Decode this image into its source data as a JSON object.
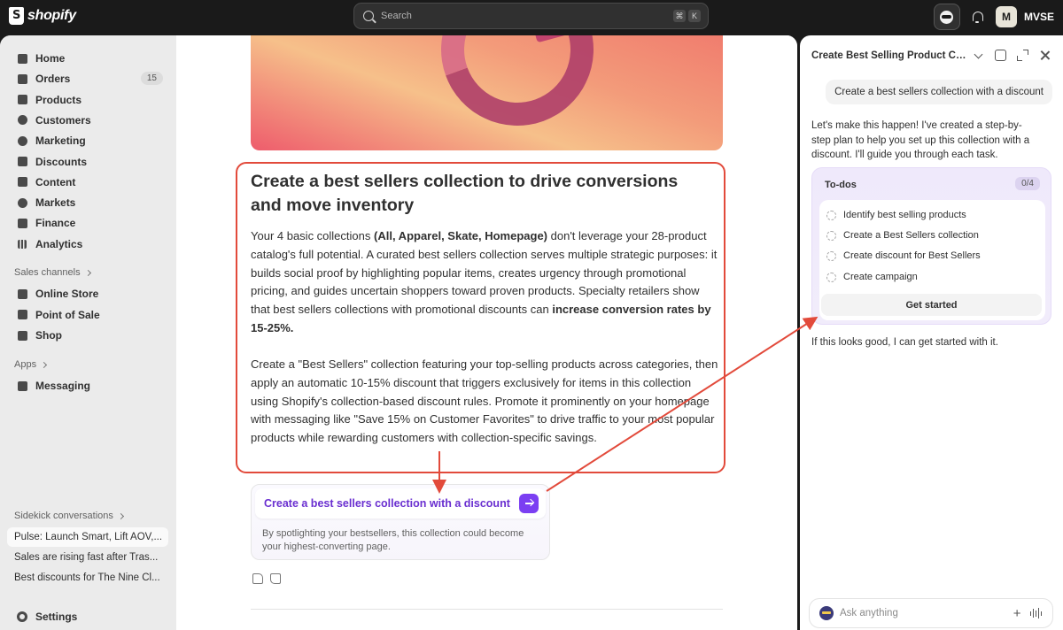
{
  "topbar": {
    "brand": "shopify",
    "search_placeholder": "Search",
    "shortcut_keys": [
      "⌘",
      "K"
    ],
    "store_initial": "M",
    "store_name": "MVSE"
  },
  "sidebar": {
    "nav": [
      {
        "label": "Home",
        "icon": "home-icon"
      },
      {
        "label": "Orders",
        "icon": "orders-icon",
        "badge": "15"
      },
      {
        "label": "Products",
        "icon": "tag-icon"
      },
      {
        "label": "Customers",
        "icon": "person-icon"
      },
      {
        "label": "Marketing",
        "icon": "target-icon"
      },
      {
        "label": "Discounts",
        "icon": "discount-icon"
      },
      {
        "label": "Content",
        "icon": "content-icon"
      },
      {
        "label": "Markets",
        "icon": "globe-icon"
      },
      {
        "label": "Finance",
        "icon": "bank-icon"
      },
      {
        "label": "Analytics",
        "icon": "bar-chart-icon"
      }
    ],
    "sales_channels_title": "Sales channels",
    "sales_channels": [
      {
        "label": "Online Store",
        "icon": "store-icon"
      },
      {
        "label": "Point of Sale",
        "icon": "pos-icon"
      },
      {
        "label": "Shop",
        "icon": "shop-icon"
      }
    ],
    "apps_title": "Apps",
    "apps": [
      {
        "label": "Messaging",
        "icon": "messaging-icon"
      }
    ],
    "conversations_title": "Sidekick conversations",
    "conversations": [
      "Pulse: Launch Smart, Lift AOV,...",
      "Sales are rising fast after Tras...",
      "Best discounts for The Nine Cl..."
    ],
    "settings_label": "Settings"
  },
  "main": {
    "title": "Create a best sellers collection to drive conversions and move inventory",
    "para1_a": "Your 4 basic collections ",
    "para1_b": "(All, Apparel, Skate, Homepage)",
    "para1_c": " don't leverage your 28-product catalog's full potential. A curated best sellers collection serves multiple strategic purposes: it builds social proof by highlighting popular items, creates urgency through promotional pricing, and guides uncertain shoppers toward proven products. Specialty retailers show that best  sellers collections with promotional discounts can ",
    "para1_d": "increase conversion rates by 15-25%.",
    "para2": "Create a \"Best Sellers\" collection featuring your top-selling products across categories, then apply an automatic 10-15% discount that triggers exclusively for items in this collection using Shopify's collection-based discount rules. Promote it prominently on your homepage with messaging like \"Save 15% on Customer Favorites\" to drive traffic to your most popular products while rewarding customers with collection-specific savings.",
    "cta_label": "Create a best sellers collection with a discount",
    "cta_desc": "By spotlighting your bestsellers, this collection could become your highest-converting page."
  },
  "panel": {
    "title": "Create Best Selling Product Coll...",
    "user_message": "Create a best sellers collection with a discount",
    "ai_message": "Let's make this happen! I've created a step-by-step plan to help you set up this collection with a discount. I'll guide you through each task.",
    "todos_title": "To-dos",
    "todos_count": "0/4",
    "todos": [
      "Identify best selling products",
      "Create a Best Sellers collection",
      "Create discount for Best Sellers",
      "Create campaign"
    ],
    "get_started": "Get started",
    "ai_message2": "If this looks good, I can get started with it.",
    "ask_placeholder": "Ask anything"
  },
  "colors": {
    "accent": "#7b3ff2",
    "annotation": "#e24a3b"
  }
}
